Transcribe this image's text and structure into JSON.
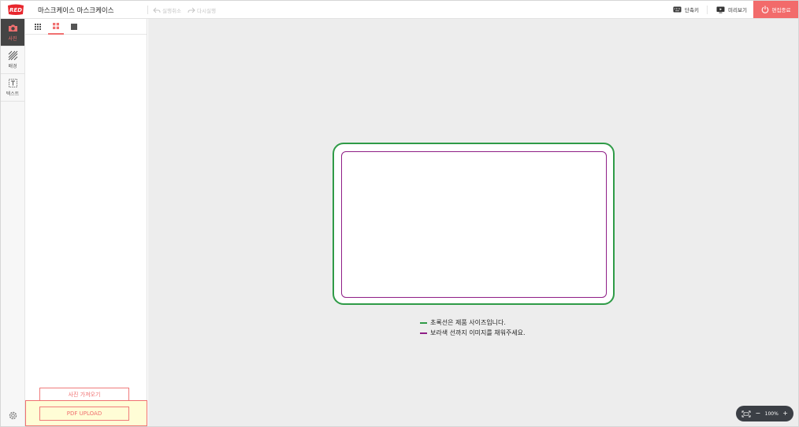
{
  "app": {
    "logo_text": "RED",
    "document_title": "마스크케이스 마스크케이스"
  },
  "history": {
    "undo_label": "실행취소",
    "redo_label": "다시실행"
  },
  "actions": {
    "shortcuts_label": "단축키",
    "preview_label": "미리보기",
    "exit_label": "편집종료"
  },
  "rail": {
    "items": [
      {
        "label": "사진",
        "icon": "camera-icon",
        "active": true
      },
      {
        "label": "배경",
        "icon": "background-pattern-icon",
        "active": false
      },
      {
        "label": "텍스트",
        "icon": "text-box-icon",
        "active": false
      }
    ],
    "settings_icon": "gear-icon"
  },
  "panel": {
    "view_tabs": [
      "grid-small-icon",
      "grid-large-icon",
      "single-view-icon"
    ],
    "active_view_tab": 1,
    "import_photo_label": "사진 가져오기",
    "pdf_upload_label": "PDF UPLOAD"
  },
  "canvas": {
    "legend": [
      {
        "text": "초록선은 제품 사이즈입니다.",
        "color": "#2f9b47"
      },
      {
        "text": "보라색 선까지 이미지를 채워주세요.",
        "color": "#8f1e86"
      }
    ],
    "product_outline_color": "#2f9b47",
    "bleed_outline_color": "#8f1e86"
  },
  "zoom": {
    "level": "100%",
    "minus": "−",
    "plus": "+"
  },
  "colors": {
    "accent": "#f26b6b",
    "highlight": "#fffdd6"
  }
}
